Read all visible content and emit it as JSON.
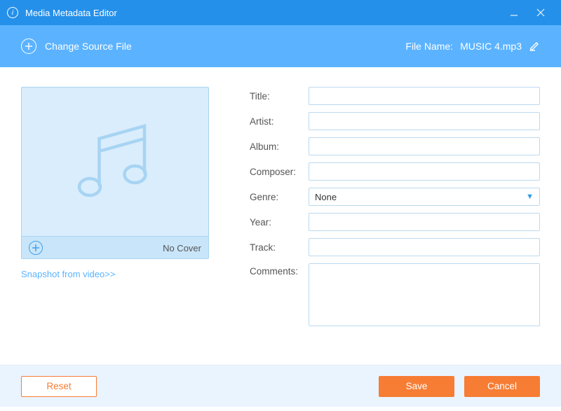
{
  "titlebar": {
    "title": "Media Metadata Editor"
  },
  "toolbar": {
    "change_source_label": "Change Source File",
    "filename_label": "File Name:",
    "filename_value": "MUSIC 4.mp3"
  },
  "cover": {
    "no_cover_label": "No Cover",
    "snapshot_link": "Snapshot from video>>"
  },
  "fields": {
    "title": {
      "label": "Title:",
      "value": ""
    },
    "artist": {
      "label": "Artist:",
      "value": ""
    },
    "album": {
      "label": "Album:",
      "value": ""
    },
    "composer": {
      "label": "Composer:",
      "value": ""
    },
    "genre": {
      "label": "Genre:",
      "value": "None"
    },
    "year": {
      "label": "Year:",
      "value": ""
    },
    "track": {
      "label": "Track:",
      "value": ""
    },
    "comments": {
      "label": "Comments:",
      "value": ""
    }
  },
  "footer": {
    "reset": "Reset",
    "save": "Save",
    "cancel": "Cancel"
  }
}
